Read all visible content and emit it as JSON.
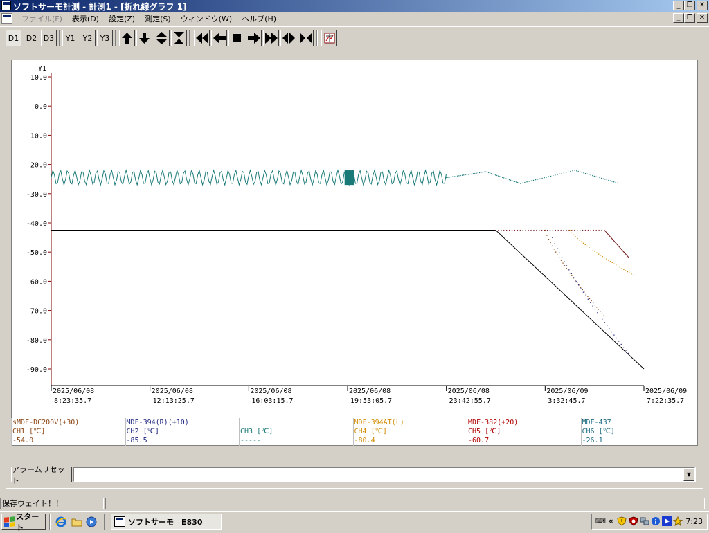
{
  "window": {
    "title": "ソフトサーモ計測 - 計測1 - [折れ線グラフ 1]"
  },
  "menu": [
    {
      "label": "ファイル(F)",
      "disabled": true
    },
    {
      "label": "表示(D)"
    },
    {
      "label": "設定(Z)"
    },
    {
      "label": "測定(S)"
    },
    {
      "label": "ウィンドウ(W)"
    },
    {
      "label": "ヘルプ(H)"
    }
  ],
  "toolbar": {
    "d1": "D1",
    "d2": "D2",
    "d3": "D3",
    "y1": "Y1",
    "y2": "Y2",
    "y3": "Y3"
  },
  "chart_data": {
    "type": "line",
    "ylabel": "Y1",
    "ylim": [
      -95,
      10
    ],
    "yticks": [
      "10.0",
      "0.0",
      "-10.0",
      "-20.0",
      "-30.0",
      "-40.0",
      "-50.0",
      "-60.0",
      "-70.0",
      "-80.0",
      "-90.0"
    ],
    "xticks": [
      [
        "2025/06/08",
        "8:23:35.7"
      ],
      [
        "2025/06/08",
        "12:13:25.7"
      ],
      [
        "2025/06/08",
        "16:03:15.7"
      ],
      [
        "2025/06/08",
        "19:53:05.7"
      ],
      [
        "2025/06/08",
        "23:42:55.7"
      ],
      [
        "2025/06/09",
        "3:32:45.7"
      ],
      [
        "2025/06/09",
        "7:22:35.7"
      ]
    ],
    "series": [
      {
        "color": "#000000",
        "x": [
          0,
          4.5,
          6
        ],
        "y": [
          -42.5,
          -42.5,
          -90
        ]
      },
      {
        "color": "#1a7a78",
        "x": [
          0,
          4.0,
          4.4,
          4.75,
          5.3,
          5.75
        ],
        "y": [
          -24.5,
          -24.5,
          -22.5,
          -26.5,
          -22,
          -26.5
        ]
      },
      {
        "color": "#7b2222",
        "x": [
          4.5,
          5.6,
          5.85
        ],
        "y": [
          -42.5,
          -42.5,
          -52
        ]
      }
    ]
  },
  "legend": [
    {
      "name": "sMDF-DC200V(+30)",
      "unit": "CH1 [℃]",
      "value": "-54.0",
      "color": "#8b4513"
    },
    {
      "name": "MDF-394(R)(+10)",
      "unit": "CH2 [℃]",
      "value": "-85.5",
      "color": "#1a237e"
    },
    {
      "name": "",
      "unit": "CH3 [℃]",
      "value": "-----",
      "color": "#1a7a78"
    },
    {
      "name": "MDF-394AT(L)",
      "unit": "CH4 [℃]",
      "value": "-80.4",
      "color": "#d08a00"
    },
    {
      "name": "MDF-382(+20)",
      "unit": "CH5 [℃]",
      "value": "-60.7",
      "color": "#b00000"
    },
    {
      "name": "MDF-437",
      "unit": "CH6 [℃]",
      "value": "-26.1",
      "color": "#1a6a80"
    }
  ],
  "alarm": {
    "button": "アラームリセット"
  },
  "status": {
    "text": "保存ウェイト！！"
  },
  "taskbar": {
    "start": "スタート",
    "task": "ソフトサーモ　E830",
    "clock": "7:23"
  }
}
